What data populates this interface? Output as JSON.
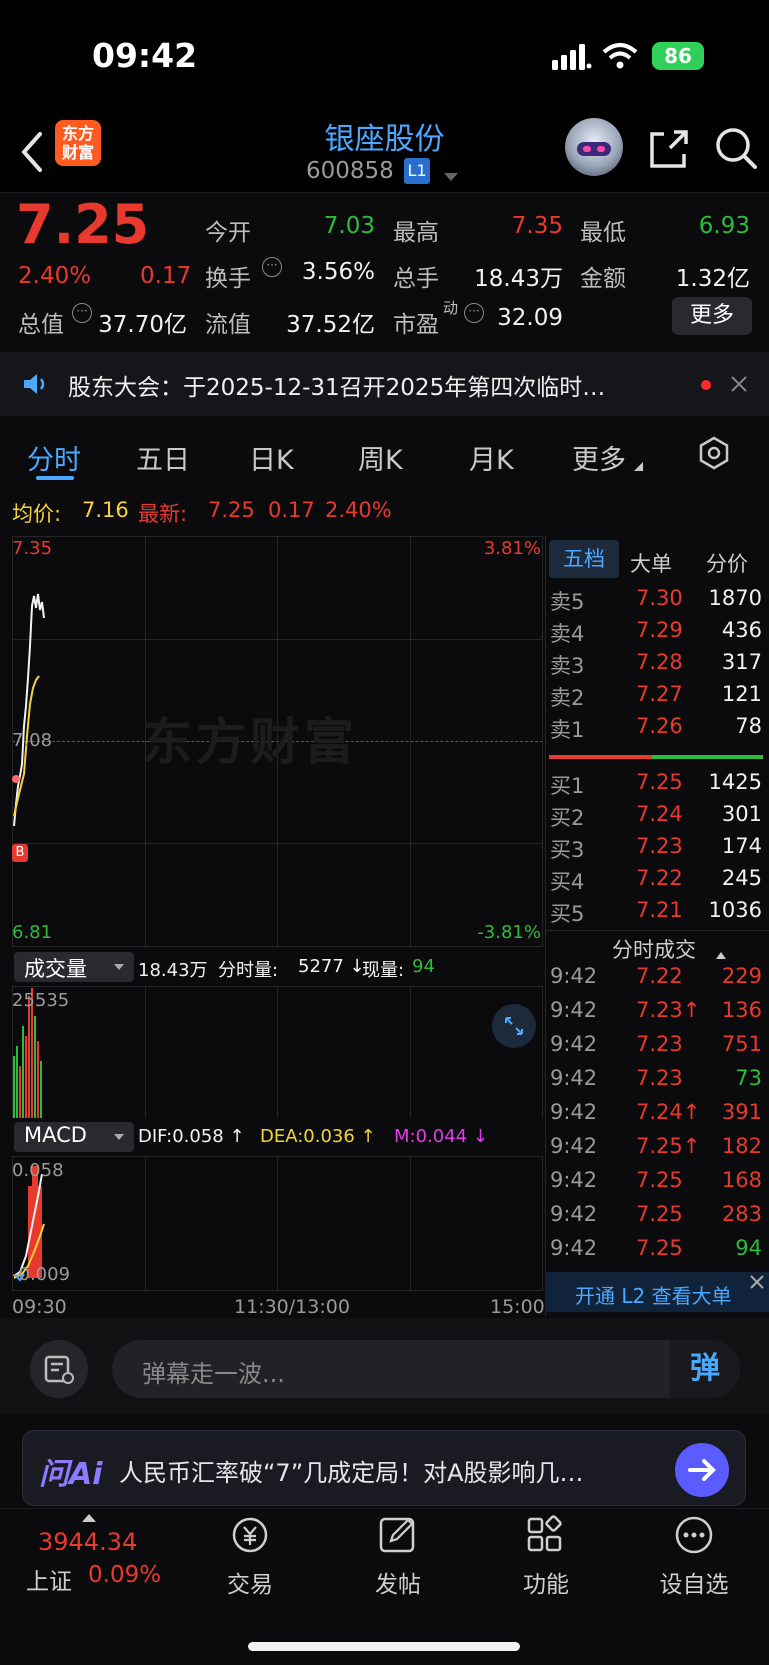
{
  "status": {
    "time": "09:42",
    "battery": "86"
  },
  "header": {
    "logo": "东方\n财富",
    "name": "银座股份",
    "code": "600858",
    "level": "L1"
  },
  "quote": {
    "price": "7.25",
    "pct": "2.40%",
    "chg": "0.17",
    "items": [
      {
        "label": "今开",
        "value": "7.03",
        "color": "green"
      },
      {
        "label": "最高",
        "value": "7.35",
        "color": "red"
      },
      {
        "label": "最低",
        "value": "6.93",
        "color": "green"
      },
      {
        "label": "换手",
        "value": "3.56%",
        "color": "white"
      },
      {
        "label": "总手",
        "value": "18.43万",
        "color": "white"
      },
      {
        "label": "金额",
        "value": "1.32亿",
        "color": "white"
      },
      {
        "label": "总值",
        "value": "37.70亿",
        "color": "white"
      },
      {
        "label": "流值",
        "value": "37.52亿",
        "color": "white"
      },
      {
        "label": "市盈",
        "value": "32.09",
        "color": "white"
      }
    ],
    "pe_sup": "动",
    "more": "更多"
  },
  "notice": {
    "text": "股东大会：于2025-12-31召开2025年第四次临时…"
  },
  "tabs": [
    "分时",
    "五日",
    "日K",
    "周K",
    "月K",
    "更多"
  ],
  "info": {
    "avg_label": "均价:",
    "avg": "7.16",
    "latest_label": "最新:",
    "latest": "7.25",
    "chg": "0.17",
    "pct": "2.40%"
  },
  "chart": {
    "y_top": "7.35",
    "y_top_pct": "3.81%",
    "y_mid": "7.08",
    "y_bot": "6.81",
    "y_bot_pct": "-3.81%",
    "watermark": "东方财富",
    "b_tag": "B"
  },
  "volume": {
    "selector": "成交量",
    "total": "18.43万",
    "period_label": "分时量:",
    "period": "5277 ↓",
    "now_label": "现量:",
    "now": "94",
    "max": "25535"
  },
  "macd": {
    "selector": "MACD",
    "dif": "DIF:0.058 ↑",
    "dea": "DEA:0.036 ↑",
    "m": "M:0.044 ↓",
    "top": "0.058",
    "bot": "-0.009"
  },
  "xaxis": {
    "start": "09:30",
    "mid": "11:30/13:00",
    "end": "15:00"
  },
  "orderbook": {
    "tabs": [
      "五档",
      "大单",
      "分价"
    ],
    "asks": [
      {
        "l": "卖5",
        "p": "7.30",
        "v": "1870"
      },
      {
        "l": "卖4",
        "p": "7.29",
        "v": "436"
      },
      {
        "l": "卖3",
        "p": "7.28",
        "v": "317"
      },
      {
        "l": "卖2",
        "p": "7.27",
        "v": "121"
      },
      {
        "l": "卖1",
        "p": "7.26",
        "v": "78"
      }
    ],
    "bids": [
      {
        "l": "买1",
        "p": "7.25",
        "v": "1425"
      },
      {
        "l": "买2",
        "p": "7.24",
        "v": "301"
      },
      {
        "l": "买3",
        "p": "7.23",
        "v": "174"
      },
      {
        "l": "买4",
        "p": "7.22",
        "v": "245"
      },
      {
        "l": "买5",
        "p": "7.21",
        "v": "1036"
      }
    ]
  },
  "trades": {
    "title": "分时成交",
    "rows": [
      {
        "t": "9:42",
        "p": "7.22",
        "v": "229",
        "vc": "red"
      },
      {
        "t": "9:42",
        "p": "7.23↑",
        "v": "136",
        "vc": "red"
      },
      {
        "t": "9:42",
        "p": "7.23",
        "v": "751",
        "vc": "red"
      },
      {
        "t": "9:42",
        "p": "7.23",
        "v": "73",
        "vc": "green"
      },
      {
        "t": "9:42",
        "p": "7.24↑",
        "v": "391",
        "vc": "red"
      },
      {
        "t": "9:42",
        "p": "7.25↑",
        "v": "182",
        "vc": "red"
      },
      {
        "t": "9:42",
        "p": "7.25",
        "v": "168",
        "vc": "red"
      },
      {
        "t": "9:42",
        "p": "7.25",
        "v": "283",
        "vc": "red"
      },
      {
        "t": "9:42",
        "p": "7.25",
        "v": "94",
        "vc": "green"
      }
    ],
    "l2": "开通 L2 查看大单"
  },
  "comment": {
    "placeholder": "弹幕走一波...",
    "send": "弹"
  },
  "ai": {
    "logo": "问Ai",
    "text": "人民币汇率破“7”几成定局！对A股影响几…"
  },
  "nav": {
    "index_val": "3944.34",
    "index_name": "上证",
    "index_pct": "0.09%",
    "items": [
      "交易",
      "发帖",
      "功能",
      "设自选"
    ]
  }
}
